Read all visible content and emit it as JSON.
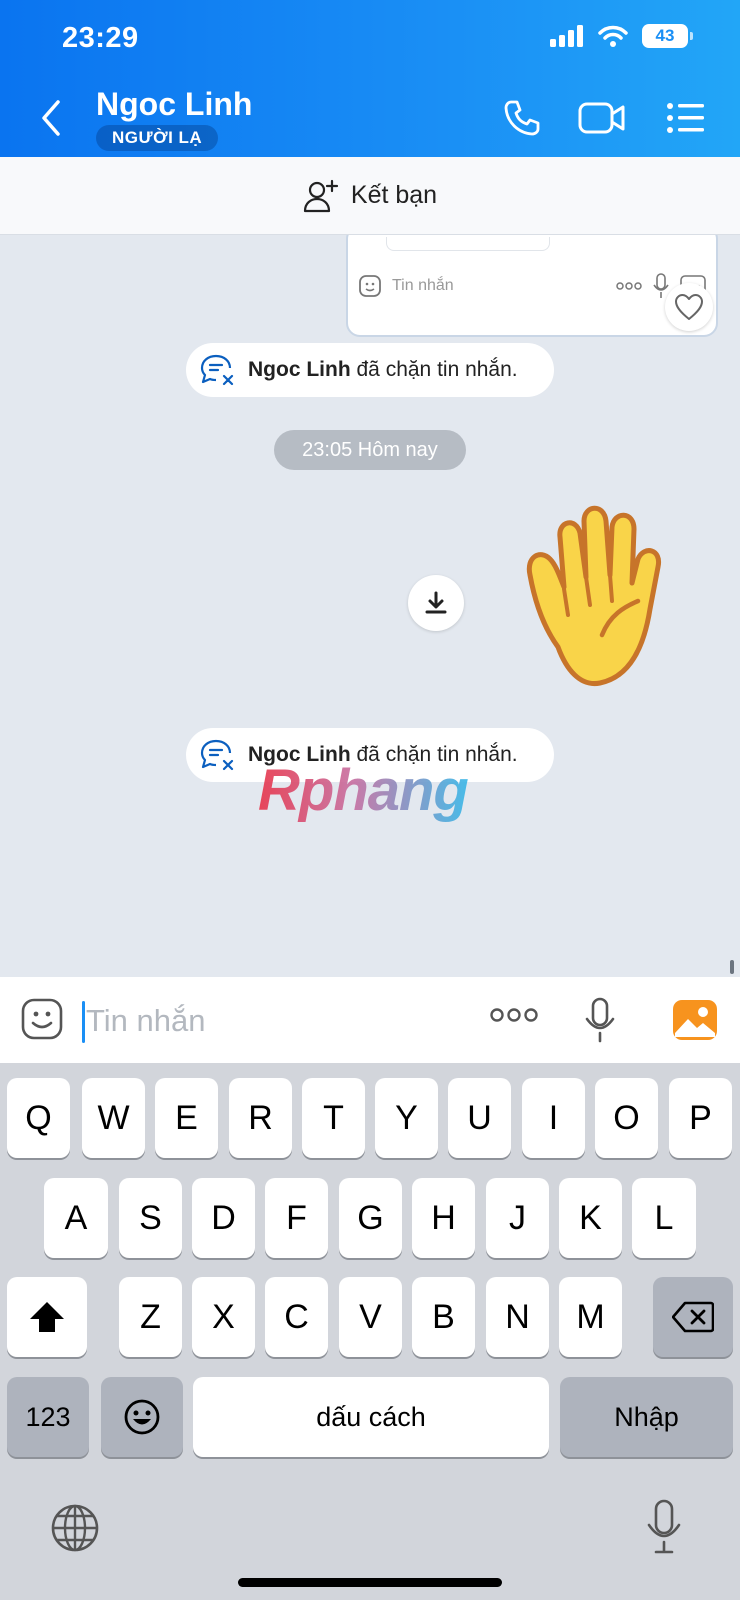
{
  "status": {
    "time": "23:29",
    "battery": "43"
  },
  "header": {
    "contact_name": "Ngoc Linh",
    "badge": "NGƯỜI LẠ"
  },
  "add_friend": {
    "label": "Kết bạn"
  },
  "quoted": {
    "input_placeholder": "Tin nhắn"
  },
  "system_messages": [
    {
      "name": "Ngoc Linh",
      "text": "đã chặn tin nhắn."
    },
    {
      "name": "Ngoc Linh",
      "text": "đã chặn tin nhắn."
    }
  ],
  "time_separator": "23:05 Hôm nay",
  "watermark": "Rphang",
  "input": {
    "placeholder": "Tin nhắn"
  },
  "keyboard": {
    "row1": [
      "Q",
      "W",
      "E",
      "R",
      "T",
      "Y",
      "U",
      "I",
      "O",
      "P"
    ],
    "row2": [
      "A",
      "S",
      "D",
      "F",
      "G",
      "H",
      "J",
      "K",
      "L"
    ],
    "row3": [
      "Z",
      "X",
      "C",
      "V",
      "B",
      "N",
      "M"
    ],
    "numbers_key": "123",
    "space_key": "dấu cách",
    "return_key": "Nhập"
  },
  "colors": {
    "header_blue": "#1a8ff5",
    "photo_orange": "#f7931e"
  }
}
